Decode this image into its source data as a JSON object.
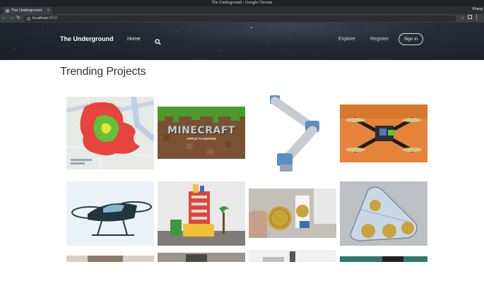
{
  "window": {
    "title": "The Underground - Google Chrome",
    "user": "Khang"
  },
  "browser": {
    "tab_title": "The Underground",
    "tab_close": "×",
    "url": "localhost",
    "url_port": ":8000",
    "back": "←",
    "forward": "→",
    "reload": "↻",
    "bookmark": "☆"
  },
  "nav": {
    "brand": "The Underground",
    "home": "Home",
    "explore": "Explore",
    "register": "Register",
    "signin": "Sign in"
  },
  "main": {
    "heading": "Trending Projects",
    "projects": [
      {
        "thumb": "heatmap-map"
      },
      {
        "thumb": "minecraft",
        "title": "MINECRAFT",
        "subtitle": "APPLE TV EDITION"
      },
      {
        "thumb": "robot-arm"
      },
      {
        "thumb": "drone"
      },
      {
        "thumb": "flying-car"
      },
      {
        "thumb": "lego-building"
      },
      {
        "thumb": "coin-gadget"
      },
      {
        "thumb": "tank-tracks"
      }
    ]
  },
  "colors": {
    "header_bg": "#22262e",
    "heatmap_red": "#e8352f",
    "heatmap_green": "#5fc23a"
  },
  "icons": [
    "search-icon",
    "info-icon",
    "star-icon",
    "close-icon"
  ]
}
